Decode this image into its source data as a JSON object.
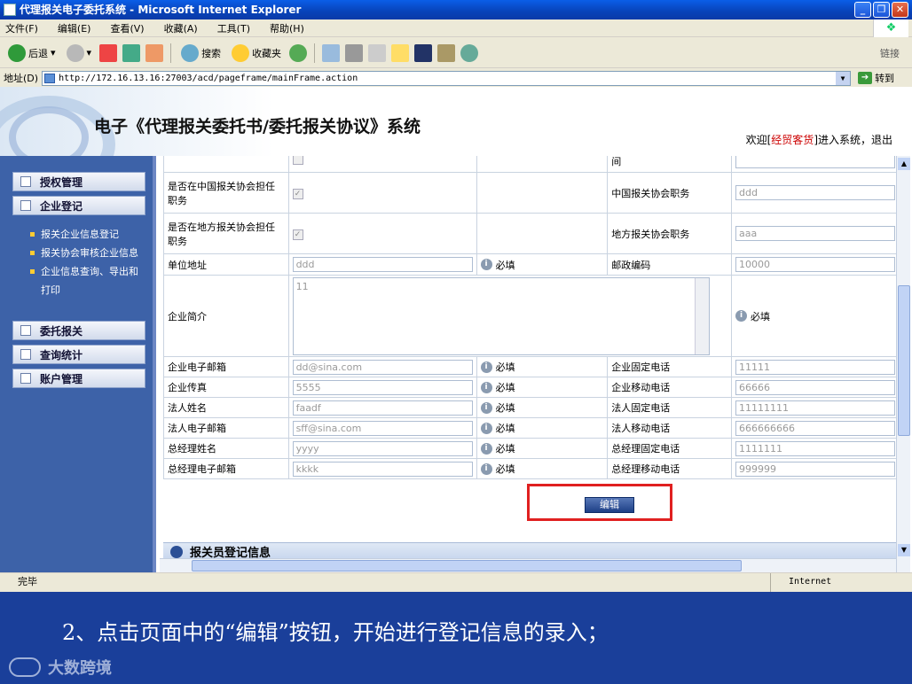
{
  "window": {
    "title": "代理报关电子委托系统 - Microsoft Internet Explorer"
  },
  "menu": [
    "文件(F)",
    "编辑(E)",
    "查看(V)",
    "收藏(A)",
    "工具(T)",
    "帮助(H)"
  ],
  "toolbar": {
    "back": "后退",
    "search": "搜索",
    "favorites": "收藏夹",
    "links": "链接"
  },
  "address": {
    "label": "地址(D)",
    "url": "http://172.16.13.16:27003/acd/pageframe/mainFrame.action",
    "go": "转到"
  },
  "header": {
    "title": "电子《代理报关委托书/委托报关协议》系统",
    "welcome_prefix": "欢迎[",
    "user": "经贸客货",
    "welcome_suffix": "]进入系统，退出"
  },
  "sidebar": {
    "items": [
      {
        "label": "授权管理"
      },
      {
        "label": "企业登记"
      },
      {
        "label": "委托报关"
      },
      {
        "label": "查询统计"
      },
      {
        "label": "账户管理"
      }
    ],
    "sub": [
      "报关企业信息登记",
      "报关协会审核企业信息",
      "企业信息查询、导出和打印"
    ]
  },
  "form": {
    "row0": {
      "right_label": "间"
    },
    "row1": {
      "label": "是否在中国报关协会担任职务",
      "right_label": "中国报关协会职务",
      "right_value": "ddd"
    },
    "row2": {
      "label": "是否在地方报关协会担任职务",
      "right_label": "地方报关协会职务",
      "right_value": "aaa"
    },
    "row3": {
      "label": "单位地址",
      "value": "ddd",
      "req": "必填",
      "right_label": "邮政编码",
      "right_value": "10000"
    },
    "row4": {
      "label": "企业简介",
      "value": "11",
      "req": "必填"
    },
    "row5": {
      "label": "企业电子邮箱",
      "value": "dd@sina.com",
      "req": "必填",
      "right_label": "企业固定电话",
      "right_value": "11111"
    },
    "row6": {
      "label": "企业传真",
      "value": "5555",
      "req": "必填",
      "right_label": "企业移动电话",
      "right_value": "66666"
    },
    "row7": {
      "label": "法人姓名",
      "value": "faadf",
      "req": "必填",
      "right_label": "法人固定电话",
      "right_value": "11111111"
    },
    "row8": {
      "label": "法人电子邮箱",
      "value": "sff@sina.com",
      "req": "必填",
      "right_label": "法人移动电话",
      "right_value": "666666666"
    },
    "row9": {
      "label": "总经理姓名",
      "value": "yyyy",
      "req": "必填",
      "right_label": "总经理固定电话",
      "right_value": "1111111"
    },
    "row10": {
      "label": "总经理电子邮箱",
      "value": "kkkk",
      "req": "必填",
      "right_label": "总经理移动电话",
      "right_value": "999999"
    }
  },
  "edit_button": "编辑",
  "section": "报关员登记信息",
  "status": {
    "text": "完毕",
    "zone": "Internet"
  },
  "caption": "2、点击页面中的“编辑”按钮，开始进行登记信息的录入；",
  "brand": "大数跨境",
  "colors": {
    "sidebar": "#3d62a8",
    "slide": "#1a3f9a",
    "highlight": "#e02020"
  }
}
